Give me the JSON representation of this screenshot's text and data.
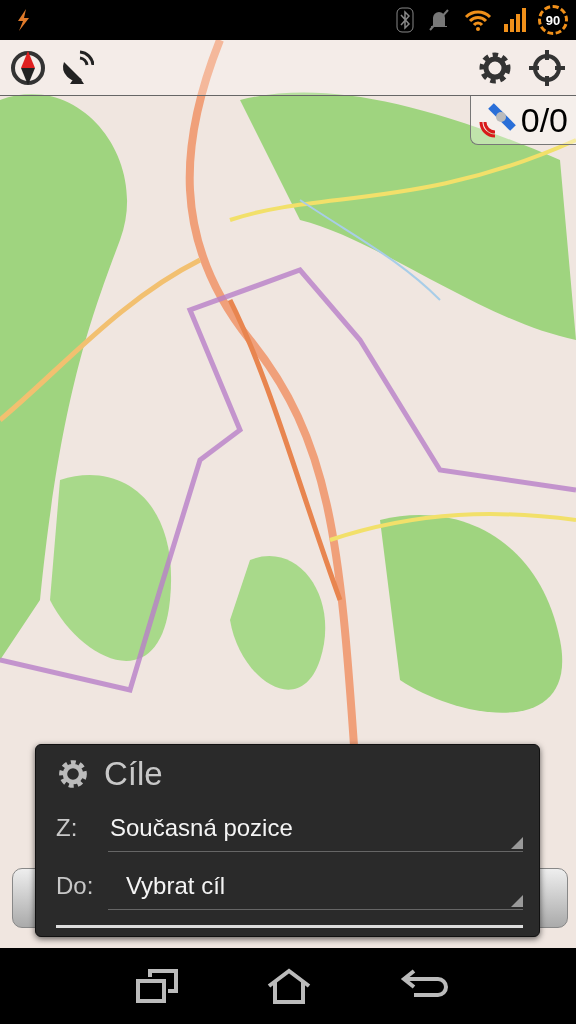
{
  "status_bar": {
    "battery": "90"
  },
  "map": {
    "gps_status": "0/0"
  },
  "dialog": {
    "title": "Cíle",
    "fields": [
      {
        "label": "Z:",
        "value": "Současná pozice"
      },
      {
        "label": "Do:",
        "value": "Vybrat cíl"
      }
    ]
  }
}
